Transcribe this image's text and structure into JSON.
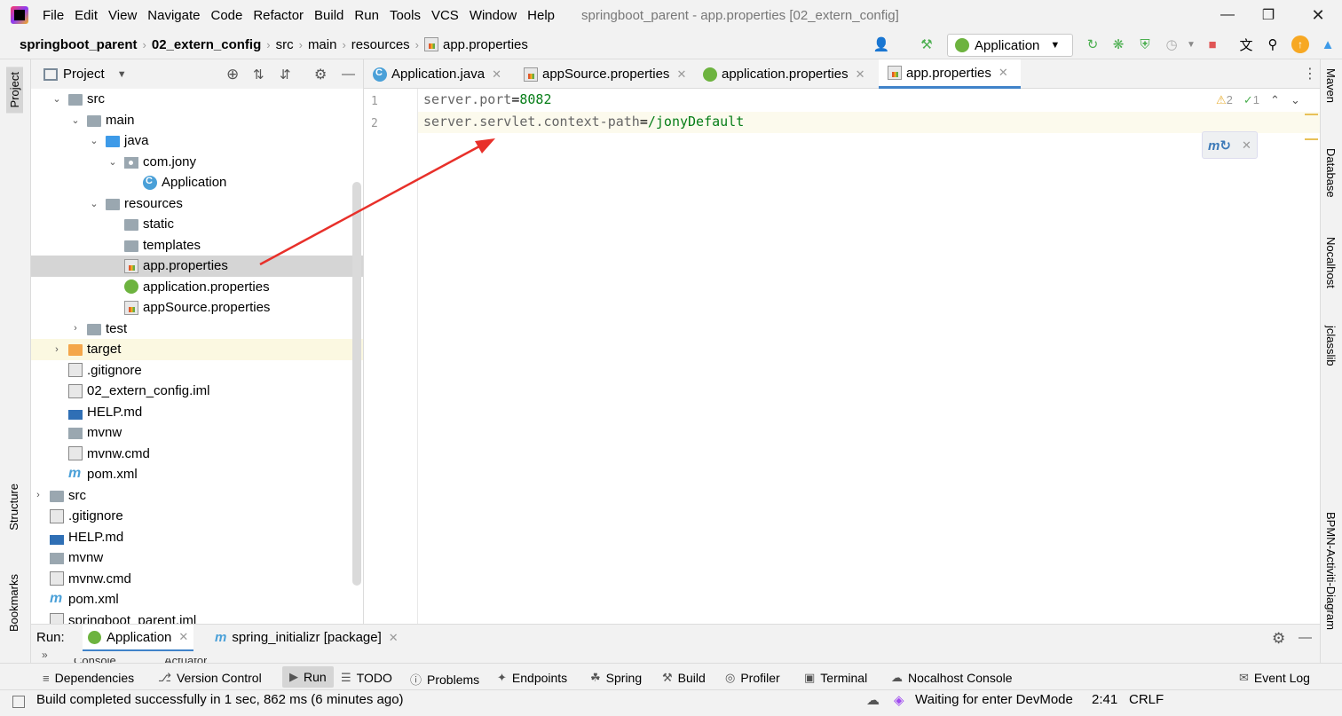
{
  "menu": [
    "File",
    "Edit",
    "View",
    "Navigate",
    "Code",
    "Refactor",
    "Build",
    "Run",
    "Tools",
    "VCS",
    "Window",
    "Help"
  ],
  "window_title": "springboot_parent - app.properties [02_extern_config]",
  "breadcrumb": [
    "springboot_parent",
    "02_extern_config",
    "src",
    "main",
    "resources",
    "app.properties"
  ],
  "run_config": "Application",
  "left_tabs": {
    "project": "Project",
    "structure": "Structure",
    "bookmarks": "Bookmarks"
  },
  "right_tabs": {
    "maven": "Maven",
    "database": "Database",
    "nocalhost": "Nocalhost",
    "jclasslib": "jclasslib",
    "bpmn": "BPMN-Activiti-Diagram"
  },
  "project_panel": {
    "title": "Project"
  },
  "tree": [
    {
      "label": "src",
      "icon": "folder-icon",
      "indent": 2,
      "expand": "open"
    },
    {
      "label": "main",
      "icon": "folder-icon",
      "indent": 3,
      "expand": "open"
    },
    {
      "label": "java",
      "icon": "source-folder-icon",
      "indent": 4,
      "expand": "open"
    },
    {
      "label": "com.jony",
      "icon": "package-icon",
      "indent": 5,
      "expand": "open"
    },
    {
      "label": "Application",
      "icon": "spring-class-icon",
      "indent": 6,
      "expand": ""
    },
    {
      "label": "resources",
      "icon": "resources-folder-icon",
      "indent": 4,
      "expand": "open"
    },
    {
      "label": "static",
      "icon": "folder-icon",
      "indent": 5,
      "expand": ""
    },
    {
      "label": "templates",
      "icon": "folder-icon",
      "indent": 5,
      "expand": ""
    },
    {
      "label": "app.properties",
      "icon": "properties-file-icon",
      "indent": 5,
      "expand": "",
      "state": "selected"
    },
    {
      "label": "application.properties",
      "icon": "spring-properties-icon",
      "indent": 5,
      "expand": ""
    },
    {
      "label": "appSource.properties",
      "icon": "properties-file-icon",
      "indent": 5,
      "expand": ""
    },
    {
      "label": "test",
      "icon": "folder-icon",
      "indent": 3,
      "expand": "closed"
    },
    {
      "label": "target",
      "icon": "excluded-folder-icon",
      "indent": 2,
      "expand": "closed",
      "state": "highlight"
    },
    {
      "label": ".gitignore",
      "icon": "ignore-file-icon",
      "indent": 2,
      "expand": ""
    },
    {
      "label": "02_extern_config.iml",
      "icon": "iml-file-icon",
      "indent": 2,
      "expand": ""
    },
    {
      "label": "HELP.md",
      "icon": "markdown-icon",
      "indent": 2,
      "expand": ""
    },
    {
      "label": "mvnw",
      "icon": "script-icon",
      "indent": 2,
      "expand": ""
    },
    {
      "label": "mvnw.cmd",
      "icon": "text-file-icon",
      "indent": 2,
      "expand": ""
    },
    {
      "label": "pom.xml",
      "icon": "maven-icon",
      "indent": 2,
      "expand": ""
    },
    {
      "label": "src",
      "icon": "folder-icon",
      "indent": 1,
      "expand": "closed"
    },
    {
      "label": ".gitignore",
      "icon": "ignore-file-icon",
      "indent": 1,
      "expand": ""
    },
    {
      "label": "HELP.md",
      "icon": "markdown-icon",
      "indent": 1,
      "expand": ""
    },
    {
      "label": "mvnw",
      "icon": "script-icon",
      "indent": 1,
      "expand": ""
    },
    {
      "label": "mvnw.cmd",
      "icon": "text-file-icon",
      "indent": 1,
      "expand": ""
    },
    {
      "label": "pom.xml",
      "icon": "maven-icon",
      "indent": 1,
      "expand": ""
    },
    {
      "label": "springboot_parent.iml",
      "icon": "iml-file-icon",
      "indent": 1,
      "expand": ""
    }
  ],
  "editor_tabs": [
    {
      "label": "Application.java",
      "icon": "java-class-icon",
      "active": false
    },
    {
      "label": "appSource.properties",
      "icon": "properties-file-icon",
      "active": false
    },
    {
      "label": "application.properties",
      "icon": "spring-properties-icon",
      "active": false
    },
    {
      "label": "app.properties",
      "icon": "properties-file-icon",
      "active": true
    }
  ],
  "code_lines": [
    {
      "n": "1",
      "key": "server.port",
      "eq": "=",
      "value": "8082"
    },
    {
      "n": "2",
      "key": "server.servlet.context-path",
      "eq": "=",
      "value": "/jonyDefault"
    }
  ],
  "inspections": {
    "warnings": "2",
    "ok": "1"
  },
  "run_panel": {
    "label": "Run:",
    "tabs": [
      "Application",
      "spring_initializr [package]"
    ],
    "subtabs": [
      "Console",
      "Actuator"
    ]
  },
  "bottom_tools": [
    "Dependencies",
    "Version Control",
    "Run",
    "TODO",
    "Problems",
    "Endpoints",
    "Spring",
    "Build",
    "Profiler",
    "Terminal",
    "Nocalhost Console",
    "Event Log"
  ],
  "status": {
    "message": "Build completed successfully in 1 sec, 862 ms (6 minutes ago)",
    "devmode": "Waiting for enter DevMode",
    "position": "2:41",
    "line_ending": "CRLF"
  },
  "colors": {
    "accent": "#4083c9",
    "selection": "#d5d5d5",
    "arrow": "#e8302a",
    "value_green": "#067d17"
  }
}
